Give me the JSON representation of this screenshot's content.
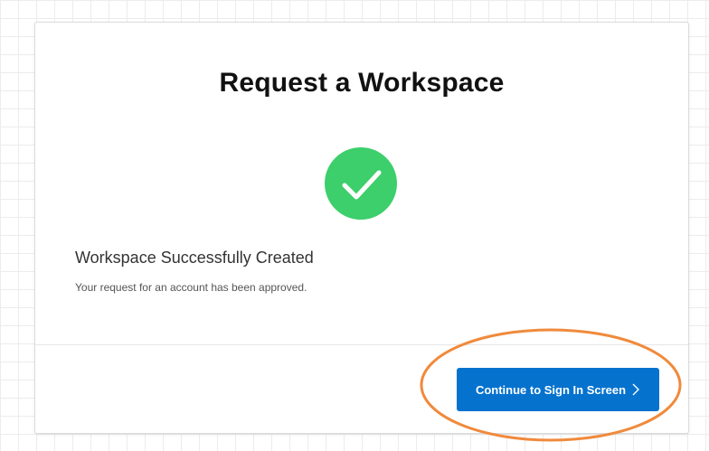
{
  "page": {
    "title": "Request a Workspace"
  },
  "status": {
    "icon": "check-circle-icon",
    "color": "#3ccf6b",
    "heading": "Workspace Successfully Created",
    "message": "Your request for an account has been approved."
  },
  "footer": {
    "continue_label": "Continue to Sign In Screen",
    "button_color": "#0572ce",
    "chevron_icon": "chevron-right-icon"
  },
  "annotation": {
    "type": "highlight-ellipse",
    "color": "#f08a3c"
  }
}
